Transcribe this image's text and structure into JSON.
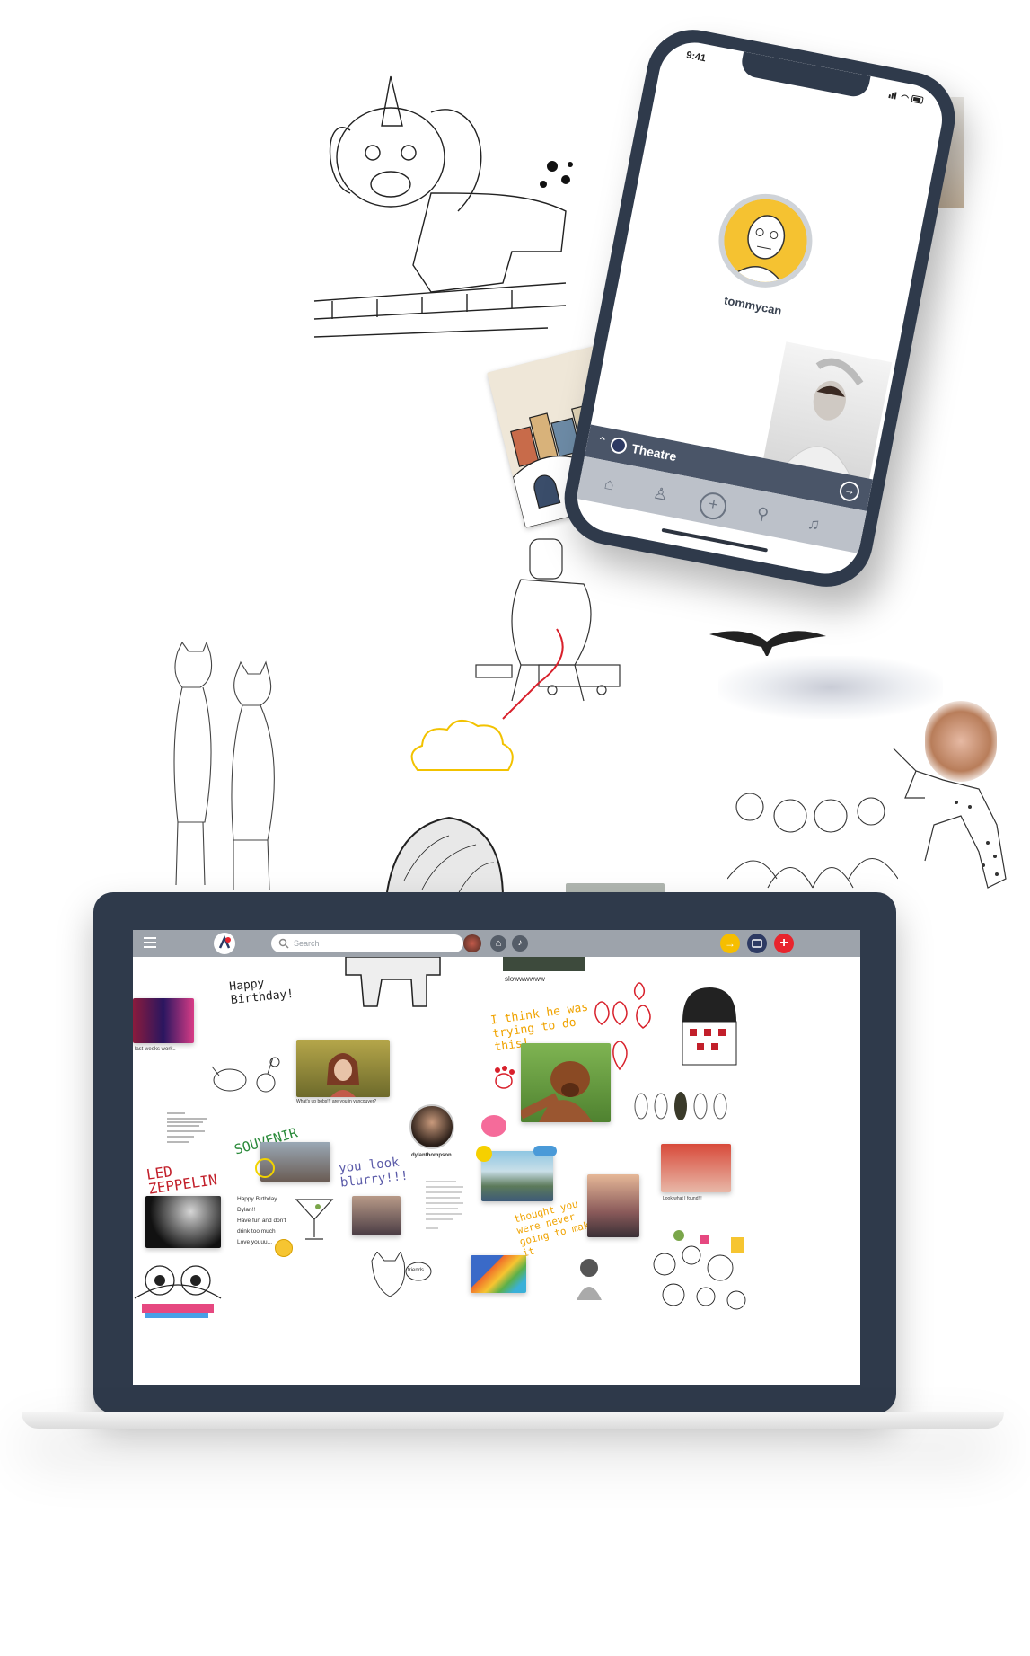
{
  "phone": {
    "status_time": "9:41",
    "status_icons": "signal-wifi-battery-icon",
    "username": "tommycan",
    "bottom_bar_label": "Theatre",
    "nav_icons": [
      "home-icon",
      "person-icon",
      "add-icon",
      "search-icon",
      "bell-icon"
    ]
  },
  "laptop": {
    "menu_icon": "hamburger-icon",
    "search": {
      "placeholder": "Search"
    },
    "toolbar_icons": [
      "avatar",
      "home-icon",
      "bell-icon"
    ],
    "action_icons": [
      "arrow-right-icon",
      "theatre-icon",
      "add-icon"
    ],
    "accent_colors": {
      "yellow": "#f6be00",
      "navy": "#2d3a63",
      "red": "#e8242d"
    },
    "board": {
      "caption_slow": "slowwwwww",
      "caption_lastweek": "last weeks work..",
      "caption_happy": "Happy Birthday!",
      "caption_whatsup": "What's up bobs!!! are you in vancouver?",
      "caption_dylan": "dylanthompson",
      "caption_lookfound": "Look what I found!!!",
      "note_think": "I think he was trying to do this!",
      "note_youlook": "you look blurry!!!",
      "note_souvenir": "SOUVENIR",
      "note_led": "LED ZEPPELIN",
      "note_never": "thought you were never going to make it",
      "note_friends": "friends",
      "birthday_card": [
        "Happy Birthday",
        "Dylan!!",
        "Have fun and don't",
        "drink too much",
        "Love youuu..."
      ]
    }
  }
}
